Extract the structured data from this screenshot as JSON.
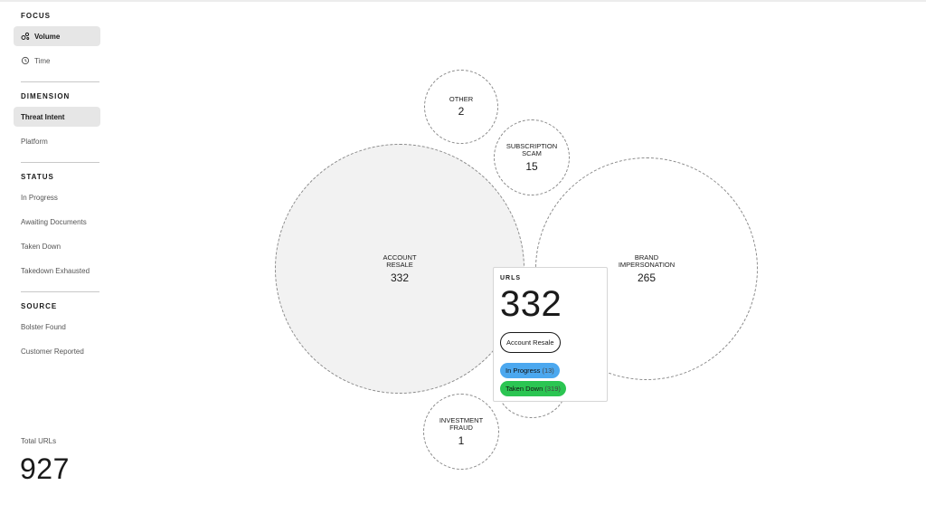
{
  "sidebar": {
    "focus": {
      "title": "FOCUS",
      "items": [
        {
          "label": "Volume",
          "icon": "volume-icon",
          "active": true
        },
        {
          "label": "Time",
          "icon": "clock-icon",
          "active": false
        }
      ]
    },
    "dimension": {
      "title": "DIMENSION",
      "items": [
        {
          "label": "Threat Intent",
          "active": true
        },
        {
          "label": "Platform",
          "active": false
        }
      ]
    },
    "status": {
      "title": "STATUS",
      "items": [
        {
          "label": "In Progress"
        },
        {
          "label": "Awaiting Documents"
        },
        {
          "label": "Taken Down"
        },
        {
          "label": "Takedown Exhausted"
        }
      ]
    },
    "source": {
      "title": "SOURCE",
      "items": [
        {
          "label": "Bolster Found"
        },
        {
          "label": "Customer Reported"
        }
      ]
    },
    "total": {
      "label": "Total URLs",
      "value": "927"
    }
  },
  "bubbles": [
    {
      "label": "OTHER",
      "value": "2"
    },
    {
      "label": "SUBSCRIPTION\nSCAM",
      "value": "15"
    },
    {
      "label": "ACCOUNT\nRESALE",
      "value": "332"
    },
    {
      "label": "BRAND\nIMPERSONATION",
      "value": "265"
    },
    {
      "label": "INVESTMENT\nFRAUD",
      "value": "1"
    }
  ],
  "tooltip": {
    "title": "URLS",
    "value": "332",
    "category": "Account Resale",
    "statuses": [
      {
        "label": "In Progress",
        "count": "(13)",
        "color": "#4ca8ef"
      },
      {
        "label": "Taken Down",
        "count": "(319)",
        "color": "#2bc552"
      }
    ]
  },
  "colors": {
    "selected_bubble_fill": "#f2f2f2",
    "active_nav_bg": "#e6e6e6"
  }
}
